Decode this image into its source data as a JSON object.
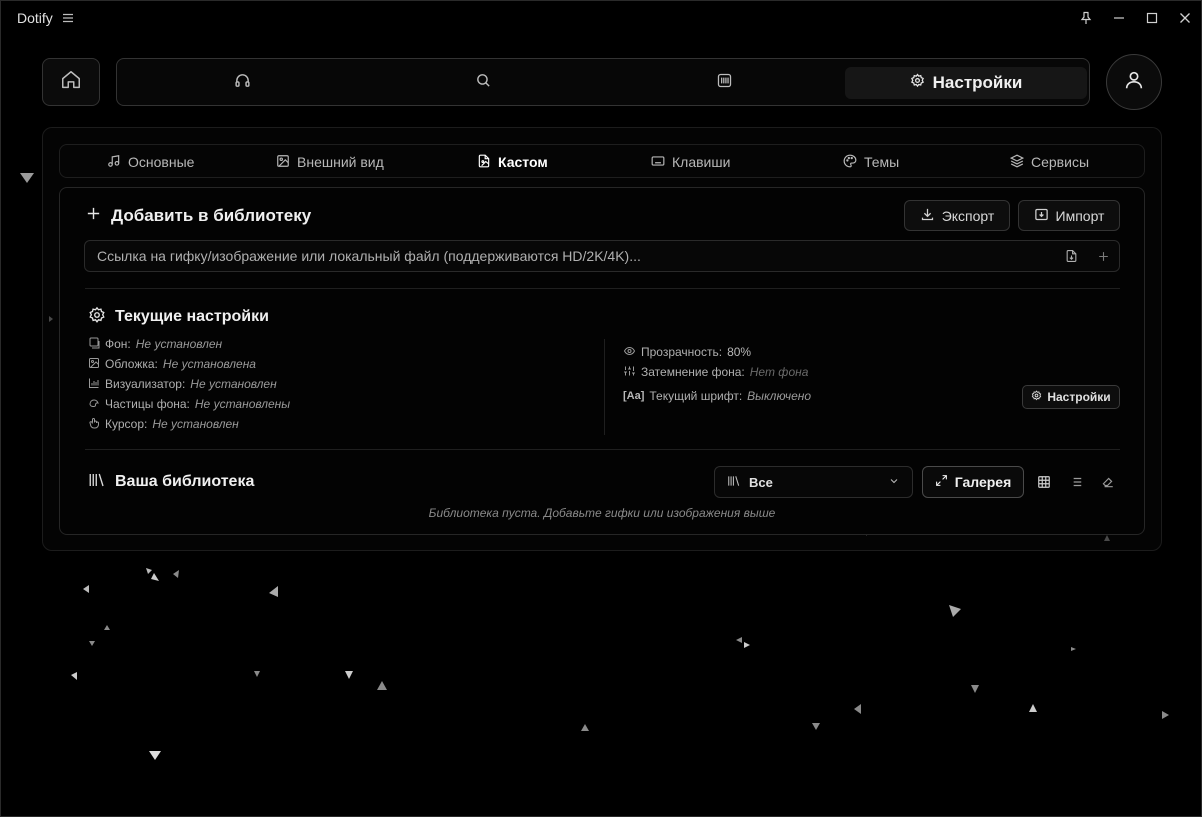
{
  "window": {
    "app_name": "Dotify",
    "controls": [
      "pin-icon",
      "minimize-icon",
      "maximize-icon",
      "close-icon"
    ]
  },
  "top_nav": {
    "home_icon": "home-icon",
    "items": [
      {
        "icon": "headphones-icon"
      },
      {
        "icon": "search-icon"
      },
      {
        "icon": "library-icon"
      }
    ],
    "active_label": "Настройки",
    "profile_icon": "user-icon"
  },
  "tabs": [
    {
      "label": "Основные",
      "icon": "music-note-icon"
    },
    {
      "label": "Внешний вид",
      "icon": "image-icon"
    },
    {
      "label": "Кастом",
      "icon": "custom-file-icon",
      "active": true
    },
    {
      "label": "Клавиши",
      "icon": "keyboard-icon"
    },
    {
      "label": "Темы",
      "icon": "palette-icon"
    },
    {
      "label": "Сервисы",
      "icon": "layers-icon"
    }
  ],
  "add_section": {
    "title": "Добавить в библиотеку",
    "export_label": "Экспорт",
    "import_label": "Импорт",
    "url_placeholder": "Ссылка на гифку/изображение или локальный файл (поддерживаются HD/2K/4K)..."
  },
  "current_settings": {
    "title": "Текущие настройки",
    "left": [
      {
        "label": "Фон:",
        "value": "Не установлен",
        "icon": "background-icon"
      },
      {
        "label": "Обложка:",
        "value": "Не установлена",
        "icon": "cover-icon"
      },
      {
        "label": "Визуализатор:",
        "value": "Не установлен",
        "icon": "visualizer-icon"
      },
      {
        "label": "Частицы фона:",
        "value": "Не установлены",
        "icon": "particles-icon"
      },
      {
        "label": "Курсор:",
        "value": "Не установлен",
        "icon": "cursor-icon"
      }
    ],
    "right": [
      {
        "label": "Прозрачность:",
        "value": "80%",
        "icon": "eye-icon"
      },
      {
        "label": "Затемнение фона:",
        "value": "Нет фона",
        "icon": "sliders-icon"
      },
      {
        "label": "Текущий шрифт:",
        "value": "Выключено",
        "badge": "[Aa]"
      }
    ],
    "settings_button": "Настройки"
  },
  "library": {
    "title": "Ваша библиотека",
    "filter_value": "Все",
    "gallery_label": "Галерея",
    "empty_text": "Библиотека пуста. Добавьте гифки или изображения выше"
  }
}
